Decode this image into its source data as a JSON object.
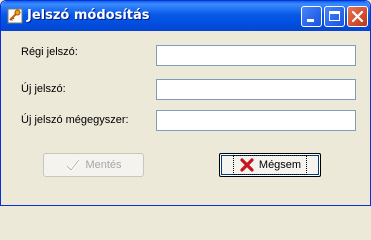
{
  "window": {
    "title": "Jelszó módosítás",
    "app_icon": "key-icon"
  },
  "title_buttons": {
    "minimize_icon": "minimize-icon",
    "maximize_icon": "maximize-icon",
    "close_icon": "close-icon"
  },
  "form": {
    "old_password_label": "Régi jelszó:",
    "new_password_label": "Új jelszó:",
    "confirm_password_label": "Új jelszó mégegyszer:",
    "old_password_value": "",
    "new_password_value": "",
    "confirm_password_value": ""
  },
  "buttons": {
    "save_label": "Mentés",
    "save_enabled": false,
    "cancel_label": "Mégsem"
  },
  "colors": {
    "titlebar": "#0559E6",
    "window_bg": "#ECE9D8",
    "close_button": "#D5502F",
    "cancel_icon": "#C8141E",
    "disabled_text": "#A7A6AA"
  }
}
